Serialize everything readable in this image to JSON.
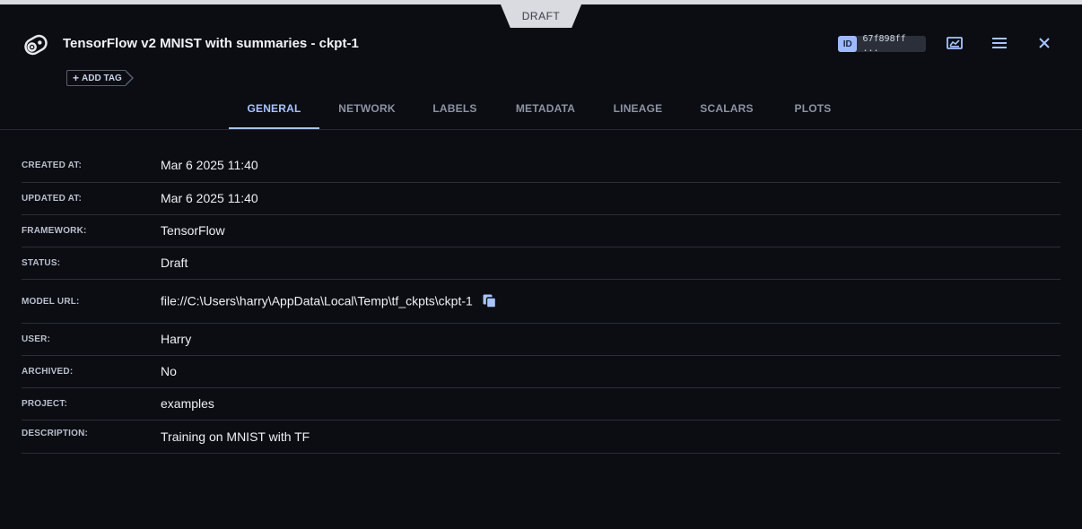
{
  "status_tab": "DRAFT",
  "header": {
    "title": "TensorFlow v2 MNIST with summaries - ckpt-1",
    "add_tag": "ADD TAG",
    "id_badge": "ID",
    "id_value": "67f898ff ..."
  },
  "tabs": [
    "GENERAL",
    "NETWORK",
    "LABELS",
    "METADATA",
    "LINEAGE",
    "SCALARS",
    "PLOTS"
  ],
  "active_tab": "GENERAL",
  "fields": [
    {
      "label": "CREATED AT:",
      "value": "Mar 6 2025 11:40"
    },
    {
      "label": "UPDATED AT:",
      "value": "Mar 6 2025 11:40"
    },
    {
      "label": "FRAMEWORK:",
      "value": "TensorFlow"
    },
    {
      "label": "STATUS:",
      "value": "Draft"
    },
    {
      "label": "MODEL URL:",
      "value": "file://C:\\Users\\harry\\AppData\\Local\\Temp\\tf_ckpts\\ckpt-1"
    },
    {
      "label": "USER:",
      "value": "Harry"
    },
    {
      "label": "ARCHIVED:",
      "value": "No"
    },
    {
      "label": "PROJECT:",
      "value": "examples"
    },
    {
      "label": "DESCRIPTION:",
      "value": "Training on MNIST with TF"
    }
  ],
  "colors": {
    "background": "#0b0d13",
    "accent": "#a8c4ff",
    "draft_tab": "#d9dbe0"
  },
  "icons": [
    "model-gear-icon",
    "plus-icon",
    "chart-icon",
    "menu-icon",
    "close-icon",
    "copy-icon"
  ]
}
